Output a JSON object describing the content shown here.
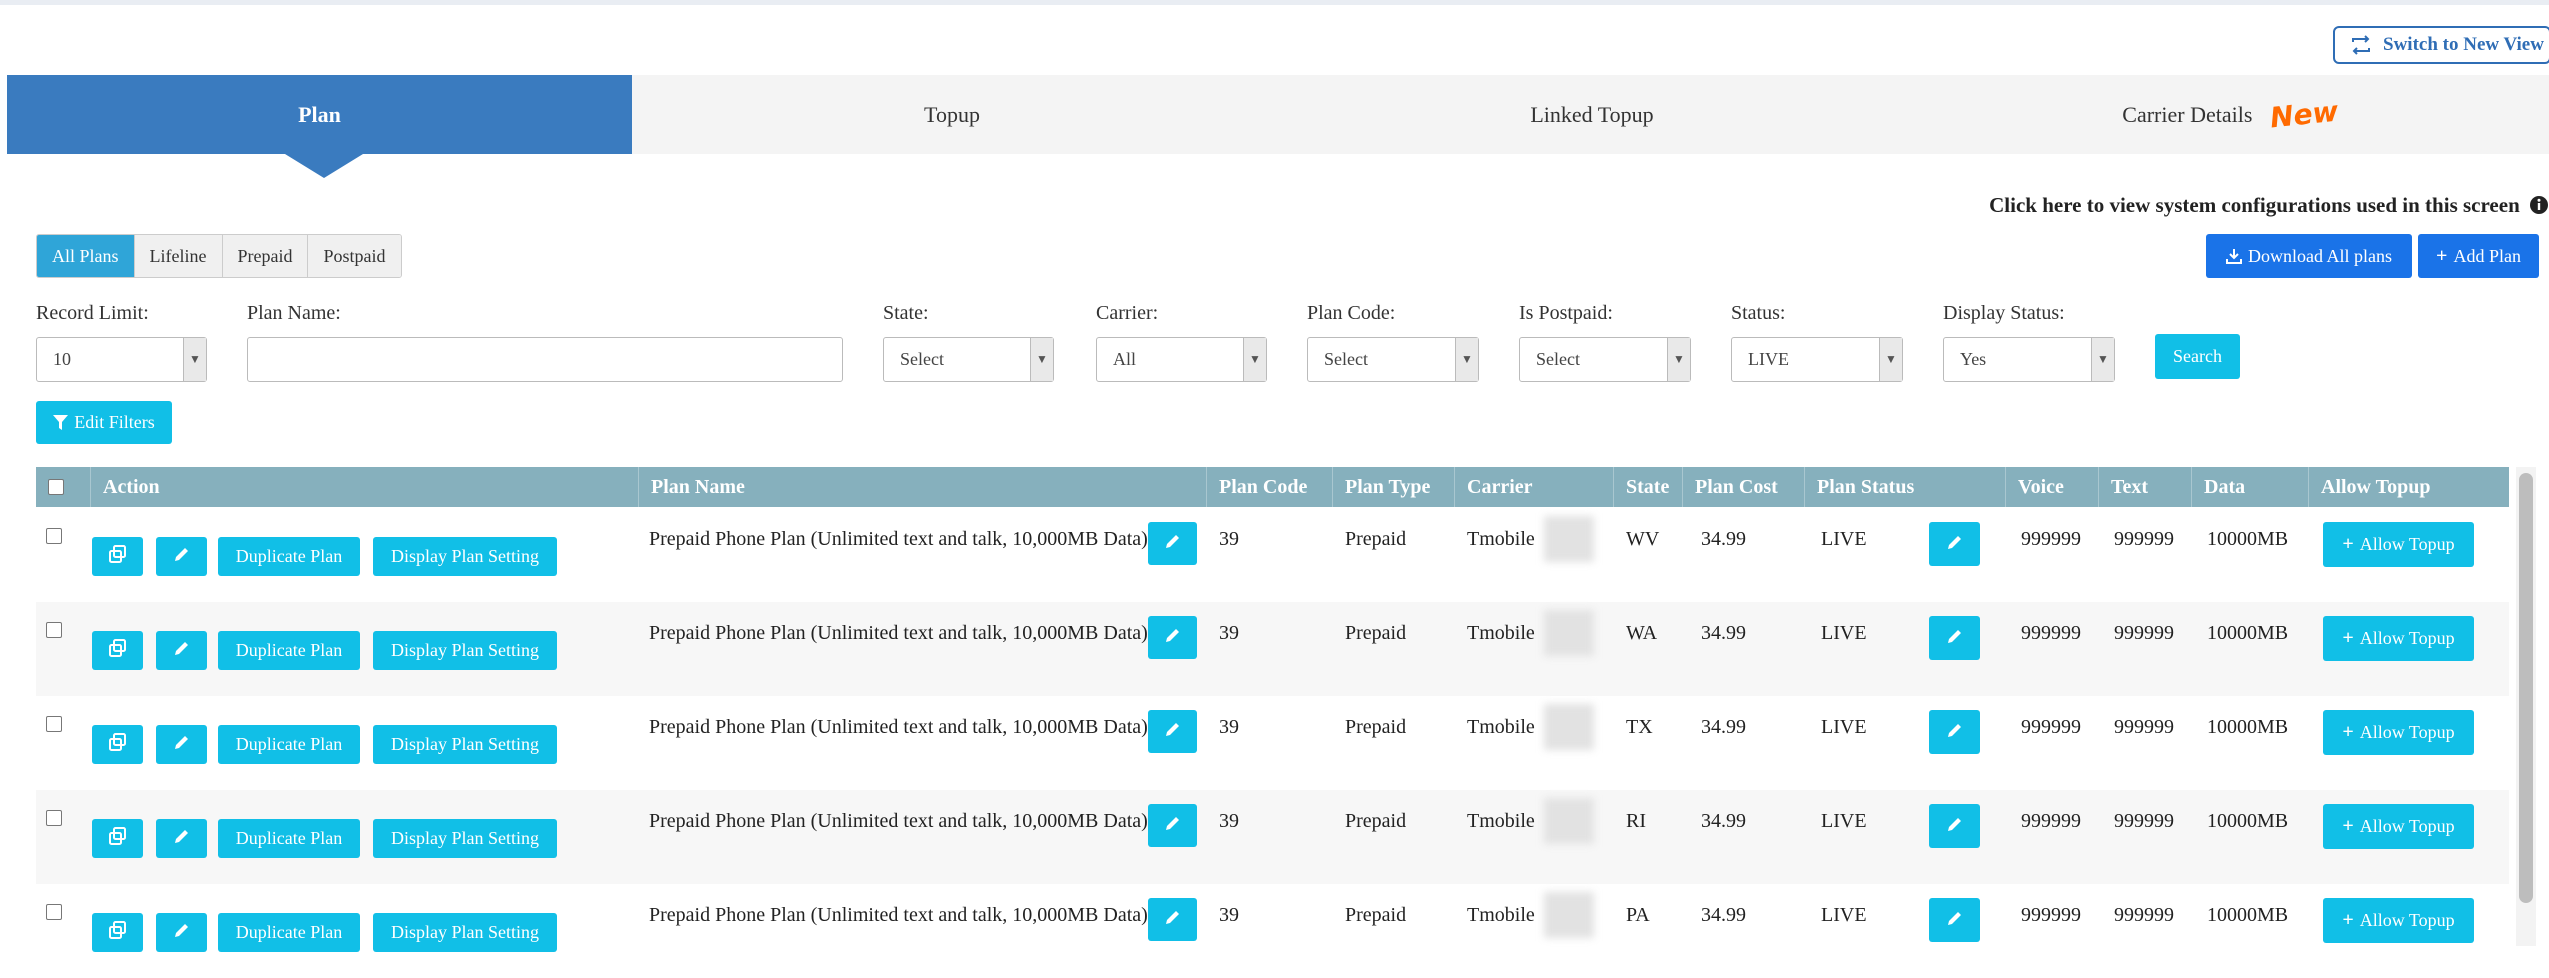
{
  "switch_view": {
    "label": "Switch to New View",
    "icon": "swap-icon"
  },
  "tabs": [
    {
      "label": "Plan",
      "active": true
    },
    {
      "label": "Topup"
    },
    {
      "label": "Linked Topup"
    },
    {
      "label": "Carrier Details",
      "badge": "New"
    }
  ],
  "config_link": "Click here to view system configurations used in this screen",
  "plan_filters": [
    "All Plans",
    "Lifeline",
    "Prepaid",
    "Postpaid"
  ],
  "actions": {
    "download": "Download All plans",
    "add": "Add Plan"
  },
  "filters": {
    "record_limit": {
      "label": "Record Limit:",
      "value": "10"
    },
    "plan_name": {
      "label": "Plan Name:",
      "value": ""
    },
    "state": {
      "label": "State:",
      "value": "Select"
    },
    "carrier": {
      "label": "Carrier:",
      "value": "All"
    },
    "plan_code": {
      "label": "Plan Code:",
      "value": "Select"
    },
    "is_postpaid": {
      "label": "Is Postpaid:",
      "value": "Select"
    },
    "status": {
      "label": "Status:",
      "value": "LIVE"
    },
    "display_status": {
      "label": "Display Status:",
      "value": "Yes"
    },
    "search_label": "Search",
    "edit_filters_label": "Edit Filters"
  },
  "table": {
    "headers": [
      "Action",
      "Plan Name",
      "Plan Code",
      "Plan Type",
      "Carrier",
      "State",
      "Plan Cost",
      "Plan Status",
      "Voice",
      "Text",
      "Data",
      "Allow Topup"
    ],
    "row_buttons": {
      "duplicate": "Duplicate Plan",
      "display": "Display Plan Setting",
      "allow_topup": "Allow Topup"
    },
    "rows": [
      {
        "name": "Prepaid Phone Plan (Unlimited text and talk, 10,000MB Data)",
        "code": "39",
        "type": "Prepaid",
        "carrier": "Tmobile",
        "state": "WV",
        "cost": "34.99",
        "status": "LIVE",
        "voice": "999999",
        "text": "999999",
        "data": "10000MB"
      },
      {
        "name": "Prepaid Phone Plan (Unlimited text and talk, 10,000MB Data)",
        "code": "39",
        "type": "Prepaid",
        "carrier": "Tmobile",
        "state": "WA",
        "cost": "34.99",
        "status": "LIVE",
        "voice": "999999",
        "text": "999999",
        "data": "10000MB"
      },
      {
        "name": "Prepaid Phone Plan (Unlimited text and talk, 10,000MB Data)",
        "code": "39",
        "type": "Prepaid",
        "carrier": "Tmobile",
        "state": "TX",
        "cost": "34.99",
        "status": "LIVE",
        "voice": "999999",
        "text": "999999",
        "data": "10000MB"
      },
      {
        "name": "Prepaid Phone Plan (Unlimited text and talk, 10,000MB Data)",
        "code": "39",
        "type": "Prepaid",
        "carrier": "Tmobile",
        "state": "RI",
        "cost": "34.99",
        "status": "LIVE",
        "voice": "999999",
        "text": "999999",
        "data": "10000MB"
      },
      {
        "name": "Prepaid Phone Plan (Unlimited text and talk, 10,000MB Data)",
        "code": "39",
        "type": "Prepaid",
        "carrier": "Tmobile",
        "state": "PA",
        "cost": "34.99",
        "status": "LIVE",
        "voice": "999999",
        "text": "999999",
        "data": "10000MB"
      }
    ]
  }
}
